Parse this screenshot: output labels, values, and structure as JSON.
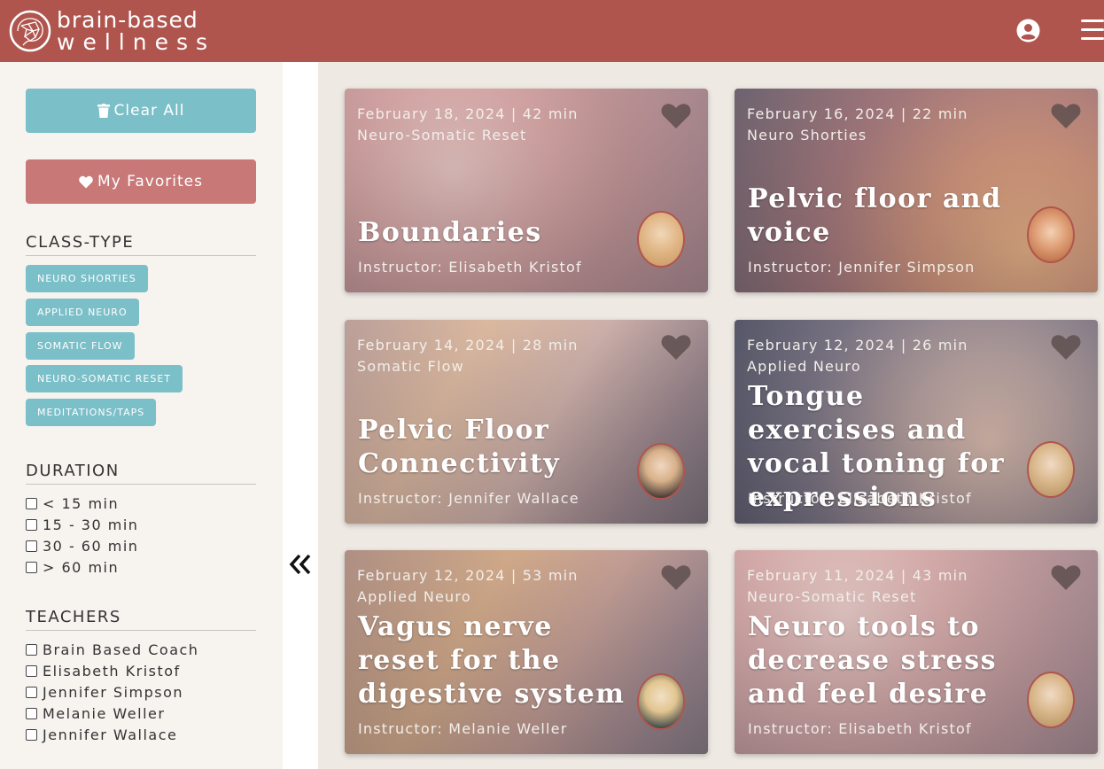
{
  "brand": {
    "line1": "brain-based",
    "line2": "wellness"
  },
  "sidebar": {
    "clear_label": "Clear All",
    "favorites_label": "My Favorites",
    "class_type": {
      "title": "CLASS-TYPE",
      "chips": [
        "NEURO SHORTIES",
        "APPLIED NEURO",
        "SOMATIC FLOW",
        "NEURO-SOMATIC RESET",
        "MEDITATIONS/TAPS"
      ]
    },
    "duration": {
      "title": "DURATION",
      "options": [
        "< 15 min",
        "15 - 30 min",
        "30 - 60 min",
        "> 60 min"
      ]
    },
    "teachers": {
      "title": "TEACHERS",
      "options": [
        "Brain Based Coach",
        "Elisabeth Kristof",
        "Jennifer Simpson",
        "Melanie Weller",
        "Jennifer Wallace"
      ]
    }
  },
  "cards": [
    {
      "meta": "February 18, 2024 | 42 min",
      "category": "Neuro-Somatic Reset",
      "title": "Boundaries",
      "instructor": "Instructor: Elisabeth Kristof"
    },
    {
      "meta": "February 16, 2024 | 22 min",
      "category": "Neuro Shorties",
      "title": "Pelvic floor and voice",
      "instructor": "Instructor: Jennifer Simpson"
    },
    {
      "meta": "February 14, 2024 | 28 min",
      "category": "Somatic Flow",
      "title": "Pelvic Floor Connectivity",
      "instructor": "Instructor: Jennifer Wallace"
    },
    {
      "meta": "February 12, 2024 | 26 min",
      "category": "Applied Neuro",
      "title": "Tongue exercises and vocal toning for expressions",
      "instructor": "Instructor: Elisabeth Kristof"
    },
    {
      "meta": "February 12, 2024 | 53 min",
      "category": "Applied Neuro",
      "title": "Vagus nerve reset for the digestive system",
      "instructor": "Instructor: Melanie Weller"
    },
    {
      "meta": "February 11, 2024 | 43 min",
      "category": "Neuro-Somatic Reset",
      "title": "Neuro tools to decrease stress and feel desire",
      "instructor": "Instructor: Elisabeth Kristof"
    }
  ],
  "colors": {
    "header": "#b0554e",
    "teal": "#7bbfc8",
    "rose": "#c97878"
  }
}
